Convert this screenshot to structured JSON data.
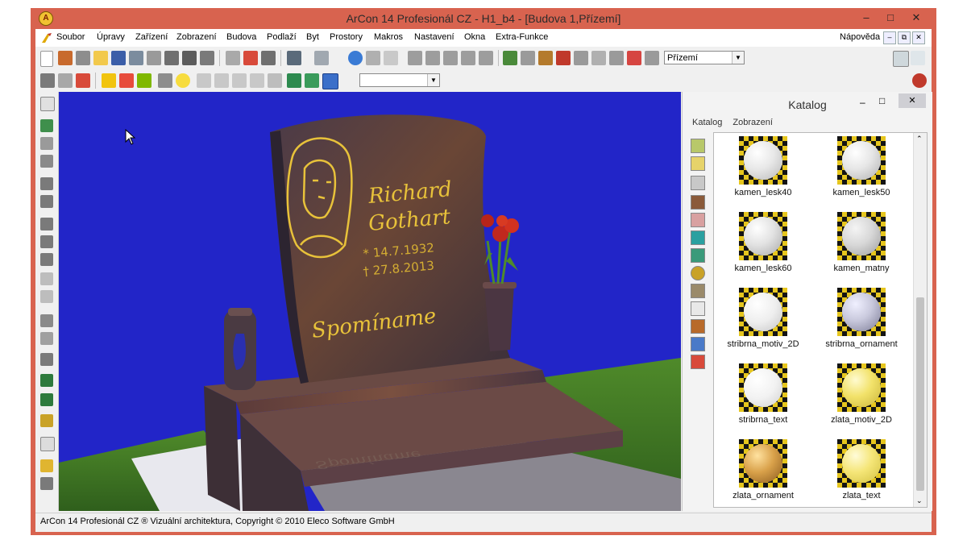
{
  "window": {
    "title": "ArCon 14 Profesionál CZ - H1_b4 - [Budova 1,Přízemí]"
  },
  "menu": {
    "items": [
      "Soubor",
      "Úpravy",
      "Zařízení",
      "Zobrazení",
      "Budova",
      "Podlaží",
      "Byt",
      "Prostory",
      "Makros",
      "Nastavení",
      "Okna",
      "Extra-Funkce"
    ],
    "help": "Nápověda"
  },
  "toolbar": {
    "floor_select": "Přízemí"
  },
  "scene": {
    "name_line1": "Richard",
    "name_line2": "Gothart",
    "birth": "* 14.7.1932",
    "death": "† 27.8.2013",
    "epitaph": "Spomíname",
    "reflection": "Spomíname"
  },
  "catalog": {
    "title": "Katalog",
    "tabs": [
      "Katalog",
      "Zobrazení"
    ],
    "items": [
      {
        "label": "kamen_lesk40"
      },
      {
        "label": "kamen_lesk50"
      },
      {
        "label": "kamen_lesk60"
      },
      {
        "label": "kamen_matny"
      },
      {
        "label": "stribrna_motiv_2D"
      },
      {
        "label": "stribrna_ornament"
      },
      {
        "label": "stribrna_text"
      },
      {
        "label": "zlata_motiv_2D"
      },
      {
        "label": "zlata_ornament"
      },
      {
        "label": "zlata_text"
      }
    ]
  },
  "status": {
    "text": "ArCon 14 Profesionál CZ ® Vizuální architektura, Copyright © 2010 Eleco Software GmbH"
  },
  "colors": {
    "window_frame": "#d8634f",
    "viewport_sky": "#2225c8",
    "gold": "#e8c23a",
    "granite": "#5a3e40"
  }
}
